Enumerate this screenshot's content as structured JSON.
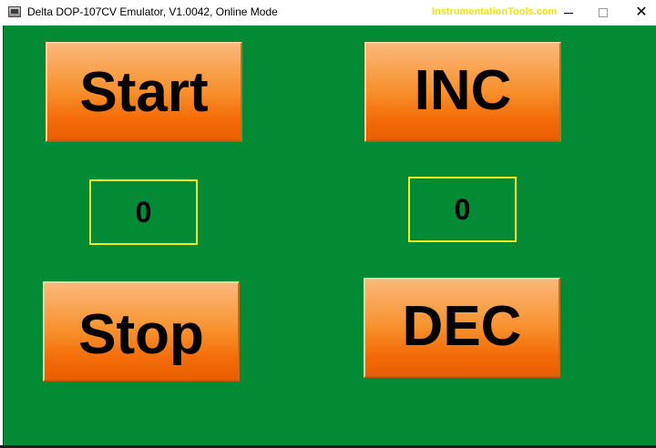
{
  "window": {
    "title": "Delta DOP-107CV Emulator, V1.0042, Online Mode",
    "watermark": "InstrumentationTools.com",
    "close_glyph": "✕"
  },
  "icons": {
    "app": "app-icon",
    "minimize": "minimize-icon",
    "maximize": "maximize-icon",
    "close": "close-icon"
  },
  "colors": {
    "screen_background": "#028a34",
    "button_orange": "#f36c08",
    "display_border": "#f0ee20",
    "watermark": "#f2e20a"
  },
  "controls": {
    "start": "Start",
    "inc": "INC",
    "stop": "Stop",
    "dec": "DEC"
  },
  "displays": {
    "left_value": "0",
    "right_value": "0"
  }
}
